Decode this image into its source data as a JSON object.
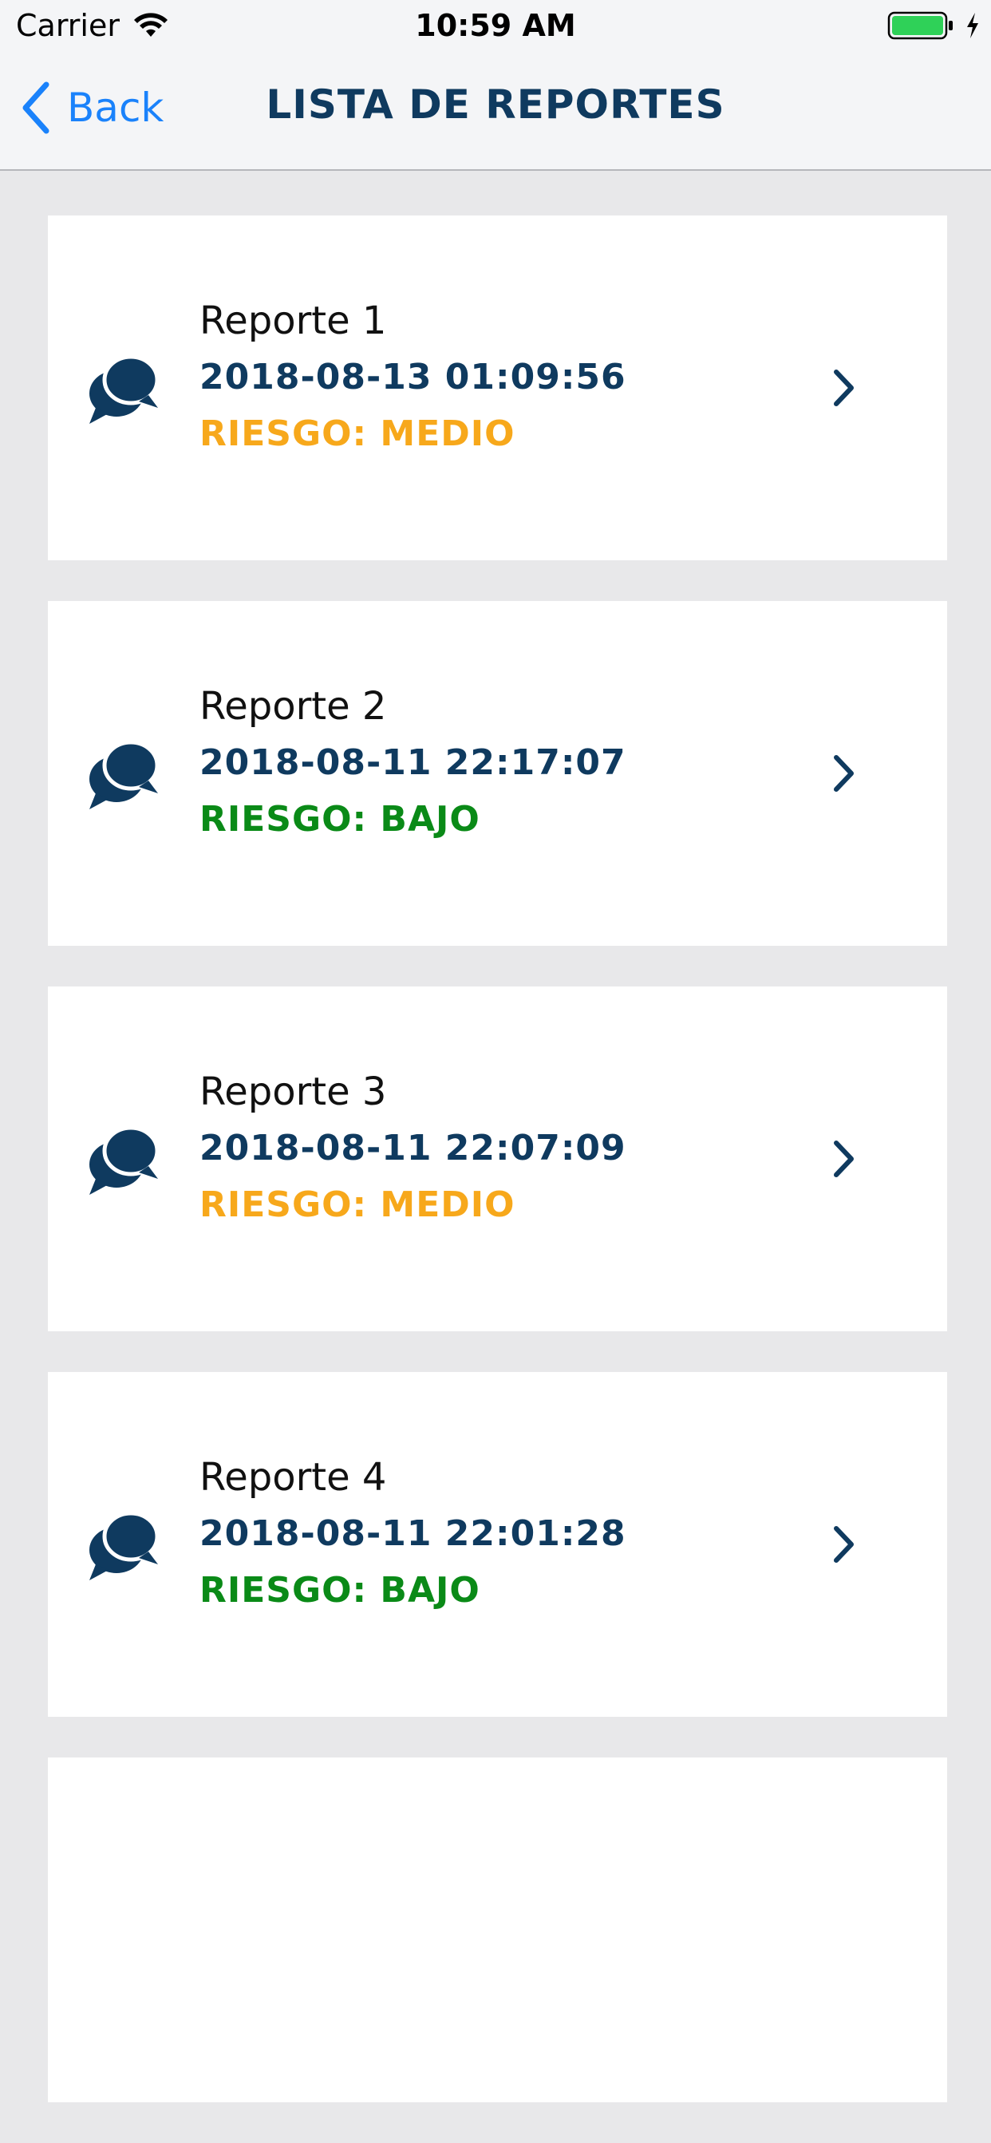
{
  "status_bar": {
    "carrier": "Carrier",
    "time": "10:59 AM",
    "wifi_icon": "wifi-icon",
    "battery_icon": "battery-full-icon",
    "charging_icon": "bolt-icon"
  },
  "navbar": {
    "back_label": "Back",
    "title": "LISTA DE REPORTES"
  },
  "colors": {
    "accent": "#1a82fb",
    "navy": "#0f3a5f",
    "risk_medio": "#f7a81b",
    "risk_bajo": "#0a8a17"
  },
  "reports": [
    {
      "title": "Reporte 1",
      "date": "2018-08-13 01:09:56",
      "risk": "RIESGO: MEDIO",
      "risk_color": "#f7a81b",
      "icon": "chat-bubbles-icon"
    },
    {
      "title": "Reporte 2",
      "date": "2018-08-11 22:17:07",
      "risk": "RIESGO: BAJO",
      "risk_color": "#0a8a17",
      "icon": "chat-bubbles-icon"
    },
    {
      "title": "Reporte 3",
      "date": "2018-08-11 22:07:09",
      "risk": "RIESGO: MEDIO",
      "risk_color": "#f7a81b",
      "icon": "chat-bubbles-icon"
    },
    {
      "title": "Reporte 4",
      "date": "2018-08-11 22:01:28",
      "risk": "RIESGO: BAJO",
      "risk_color": "#0a8a17",
      "icon": "chat-bubbles-icon"
    }
  ]
}
